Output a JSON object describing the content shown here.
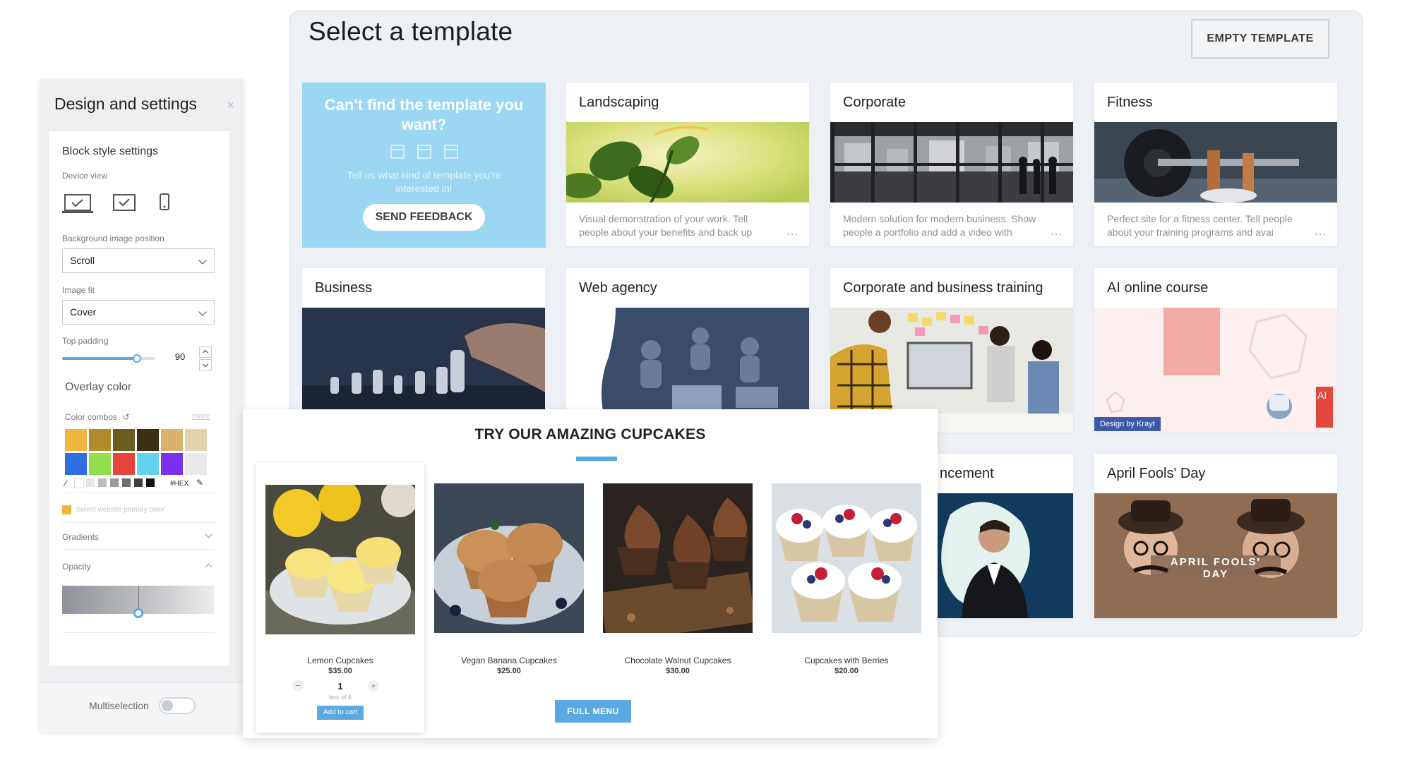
{
  "templates": {
    "title": "Select a template",
    "empty_button": "EMPTY TEMPLATE",
    "feedback": {
      "title": "Can't find the template you want?",
      "text": "Tell us what kind of template you're interested in!",
      "button": "SEND FEEDBACK"
    },
    "cards": [
      {
        "title": "Landscaping",
        "desc": "Visual demonstration of your work. Tell people about your benefits and back up"
      },
      {
        "title": "Corporate",
        "desc": "Modern solution for modern business. Show people a portfolio and add a video with"
      },
      {
        "title": "Fitness",
        "desc": "Perfect site for a fitness center. Tell people about your training programs and avai"
      },
      {
        "title": "Business"
      },
      {
        "title": "Web agency"
      },
      {
        "title": "Corporate and business training"
      },
      {
        "title": "AI online course",
        "badge": "Design by Krayt",
        "tag": "AI"
      },
      {
        "title": "ncement"
      },
      {
        "title": "April Fools' Day",
        "banner": "APRIL FOOLS' DAY"
      }
    ],
    "more_dots": "…"
  },
  "settings": {
    "title": "Design and settings",
    "close": "×",
    "block_style": "Block style settings",
    "device_view": "Device view",
    "bg_position_label": "Background image position",
    "bg_position_value": "Scroll",
    "image_fit_label": "Image fit",
    "image_fit_value": "Cover",
    "top_padding_label": "Top padding",
    "top_padding_value": "90",
    "top_padding_level": 0.8,
    "overlay_color": "Overlay color",
    "color_combos": "Color combos",
    "more": "more",
    "hex": "#HEX",
    "primary_color": "Select website primary color",
    "gradients": "Gradients",
    "opacity": "Opacity",
    "opacity_level": 0.5,
    "multiselection": "Multiselection",
    "swatches_row1": [
      "#f0b53c",
      "#b08b2e",
      "#6d5a1f",
      "#3b2f14",
      "#d9b26e",
      "#e3d3ac"
    ],
    "swatches_row2": [
      "#2d6ee0",
      "#8fe04c",
      "#e8453c",
      "#63d3f0",
      "#7b2ff0",
      "#e9e9eb"
    ],
    "mini_swatches": [
      "#ffffff",
      "#e5e5e5",
      "#bdbdbd",
      "#9a9a9a",
      "#6e6e6e",
      "#404040",
      "#111111"
    ]
  },
  "cupcakes": {
    "title": "TRY OUR AMAZING CUPCAKES",
    "full_menu": "FULL MENU",
    "add_to_cart": "Add to cart",
    "qty": "1",
    "qty_minus": "−",
    "qty_plus": "+",
    "qty_note": "box of 6",
    "products": [
      {
        "name": "Lemon Cupcakes",
        "price": "$35.00"
      },
      {
        "name": "Vegan Banana Cupcakes",
        "price": "$25.00"
      },
      {
        "name": "Chocolate Walnut Cupcakes",
        "price": "$30.00"
      },
      {
        "name": "Cupcakes with Berries",
        "price": "$20.00"
      }
    ]
  }
}
